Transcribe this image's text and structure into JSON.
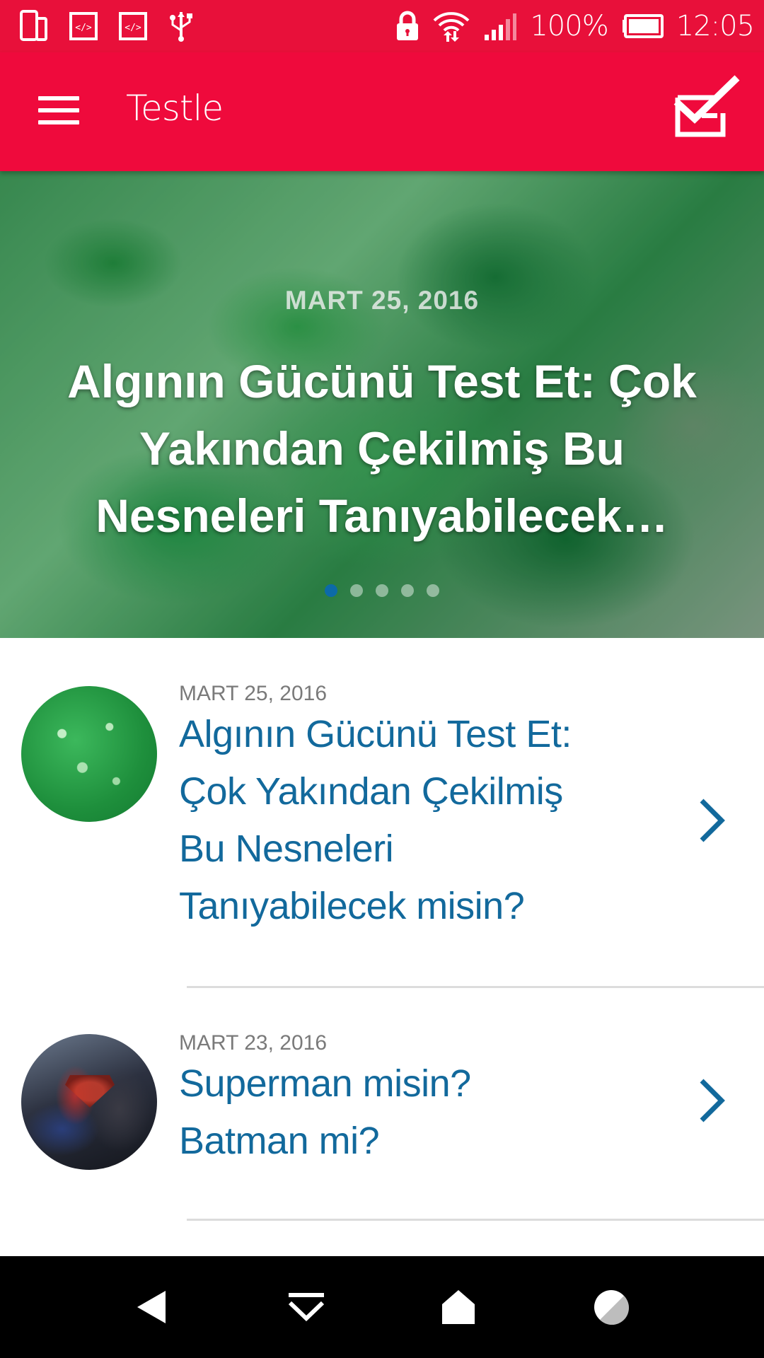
{
  "status_bar": {
    "battery": "100%",
    "time": "12:05",
    "icons": [
      "phone-icon",
      "code-icon",
      "code-icon",
      "usb-icon",
      "lock-icon",
      "wifi-icon",
      "signal-icon",
      "battery-icon"
    ]
  },
  "app_bar": {
    "title": "Testle",
    "menu_icon": "hamburger-menu-icon",
    "logo_icon": "checkmark-box-icon"
  },
  "featured": {
    "date": "MART 25, 2016",
    "title": "Algının Gücünü Test Et: Çok Yakından Çekilmiş Bu Nesneleri Tanıyabilecek…",
    "page_count": 5,
    "active_page": 1
  },
  "articles": [
    {
      "date": "MART 25, 2016",
      "title": "Algının Gücünü Test Et: Çok Yakından Çekilmiş Bu Nesneleri Tanıyabilecek misin?"
    },
    {
      "date": "MART 23, 2016",
      "title": "Superman misin? Batman mi?"
    }
  ],
  "colors": {
    "status_bar": "#e8103a",
    "app_bar": "#ef0a3c",
    "title_blue": "#12699c",
    "active_dot": "#0c6aa8"
  },
  "nav_bar": {
    "icons": [
      "back-icon",
      "recents-down-icon",
      "home-icon",
      "assistant-icon"
    ]
  }
}
